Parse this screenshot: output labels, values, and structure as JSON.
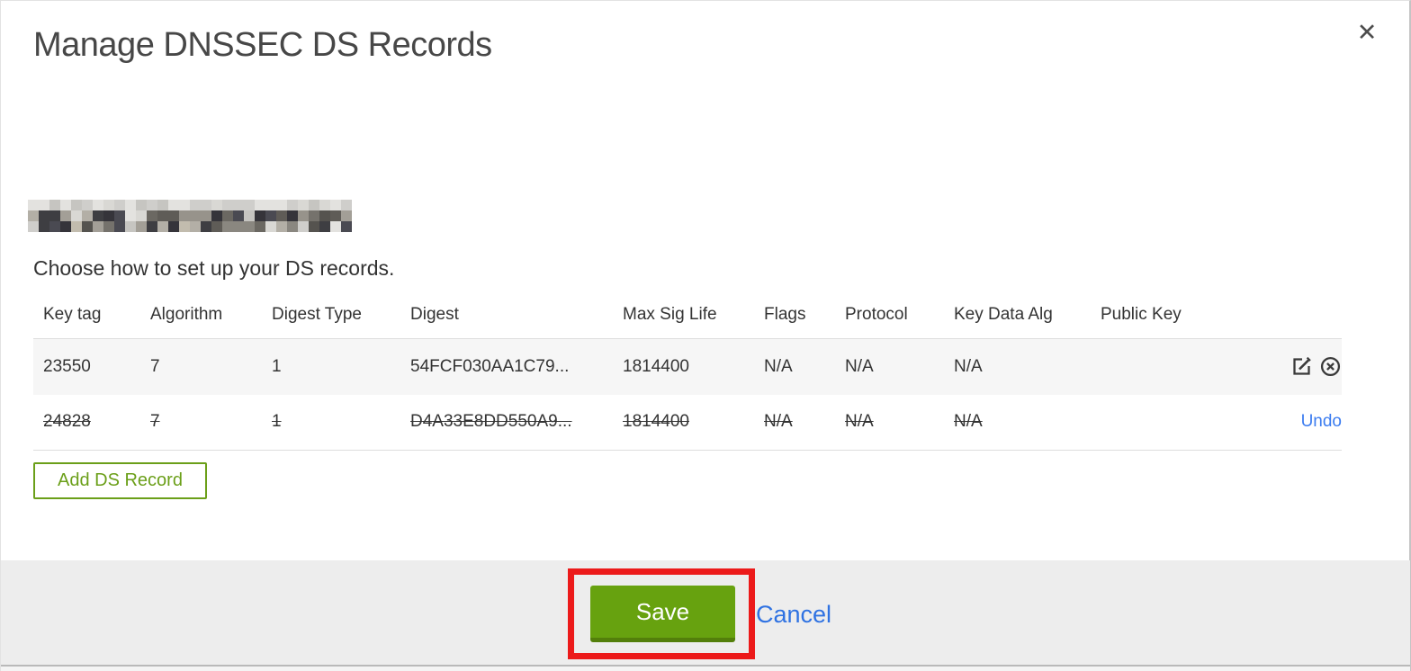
{
  "title": "Manage DNSSEC DS Records",
  "close_glyph": "✕",
  "instruction": "Choose how to set up your DS records.",
  "table": {
    "headers": [
      "Key tag",
      "Algorithm",
      "Digest Type",
      "Digest",
      "Max Sig Life",
      "Flags",
      "Protocol",
      "Key Data Alg",
      "Public Key"
    ],
    "rows": [
      {
        "cells": [
          "23550",
          "7",
          "1",
          "54FCF030AA1C79...",
          "1814400",
          "N/A",
          "N/A",
          "N/A",
          ""
        ],
        "state": "active"
      },
      {
        "cells": [
          "24828",
          "7",
          "1",
          "D4A33E8DD550A9...",
          "1814400",
          "N/A",
          "N/A",
          "N/A",
          ""
        ],
        "state": "deleted",
        "undo_label": "Undo"
      }
    ]
  },
  "actions": {
    "add_label": "Add DS Record"
  },
  "footer": {
    "save_label": "Save",
    "cancel_label": "Cancel"
  },
  "colors": {
    "button_green_outline": "#6b9f19",
    "save_green": "#67a20f",
    "save_green_shadow": "#537f0b",
    "link_blue": "#3b7cf0",
    "cancel_blue": "#2f72e2",
    "annotation_red": "#ec1a1a",
    "footer_bg": "#ededed",
    "active_row_bg": "#f6f6f6",
    "row_border": "#dddddd",
    "title_gray": "#474747"
  },
  "redaction": {
    "cols": 30,
    "rows": 3,
    "cell": 12,
    "palette_light": [
      "#d9d8d4",
      "#cfcecb",
      "#e3e2df",
      "#c6c5c1"
    ],
    "palette_dark": [
      "#3e3e42",
      "#55534f",
      "#6b6862",
      "#8a8780",
      "#a39f97",
      "#4a4a52",
      "#75726c",
      "#97938b",
      "#5f5c57",
      "#b3afa6",
      "#35343a",
      "#c2bcae"
    ]
  }
}
